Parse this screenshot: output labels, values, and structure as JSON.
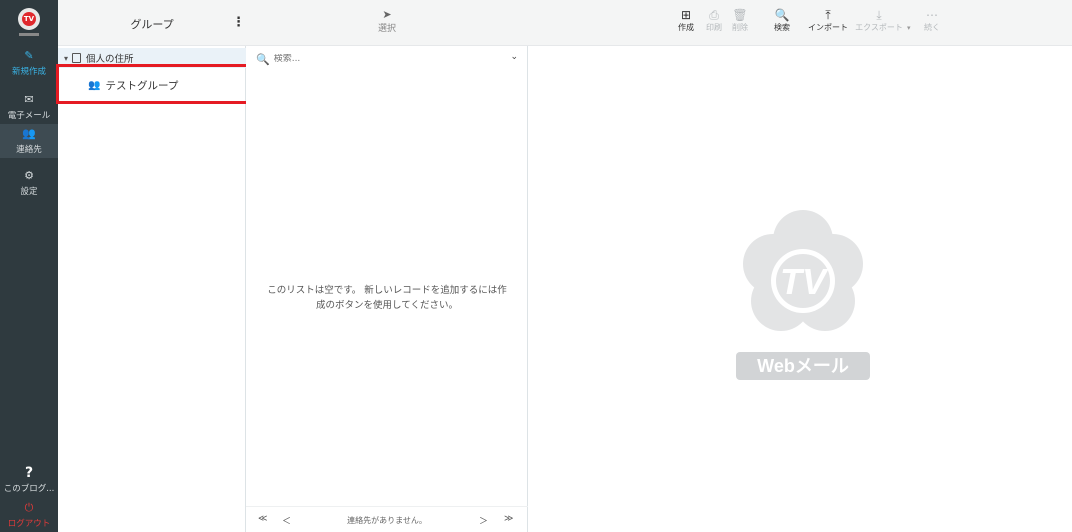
{
  "taskmenu": {
    "logo_text": "TV",
    "compose_label": "新規作成",
    "mail_label": "電子メール",
    "contacts_label": "連絡先",
    "settings_label": "設定",
    "help_label": "このブログ...",
    "logout_label": "ログアウト"
  },
  "groups": {
    "title": "グループ",
    "menu_icon": "⋮",
    "addressbook_label": "個人の住所",
    "items": [
      {
        "label": "テストグループ"
      }
    ]
  },
  "list": {
    "select_label": "選択",
    "search_placeholder": "検索...",
    "empty_message": "このリストは空です。 新しいレコードを追加するには作成のボタンを使用してください。",
    "pager": {
      "first": "≪",
      "prev": "＜",
      "count": "連絡先がありません。",
      "next": "＞",
      "last": "≫"
    }
  },
  "toolbar": {
    "create": "作成",
    "print": "印刷",
    "delete": "削除",
    "search": "検索",
    "import": "インポート",
    "export": "エクスポート",
    "more": "続く"
  },
  "watermark": {
    "logo_text": "TV",
    "label": "Webメール"
  },
  "colors": {
    "taskmenu_bg": "#2f3a3f",
    "accent": "#3ab3e5",
    "logout": "#e03a3a",
    "highlight": "#e51b23"
  }
}
